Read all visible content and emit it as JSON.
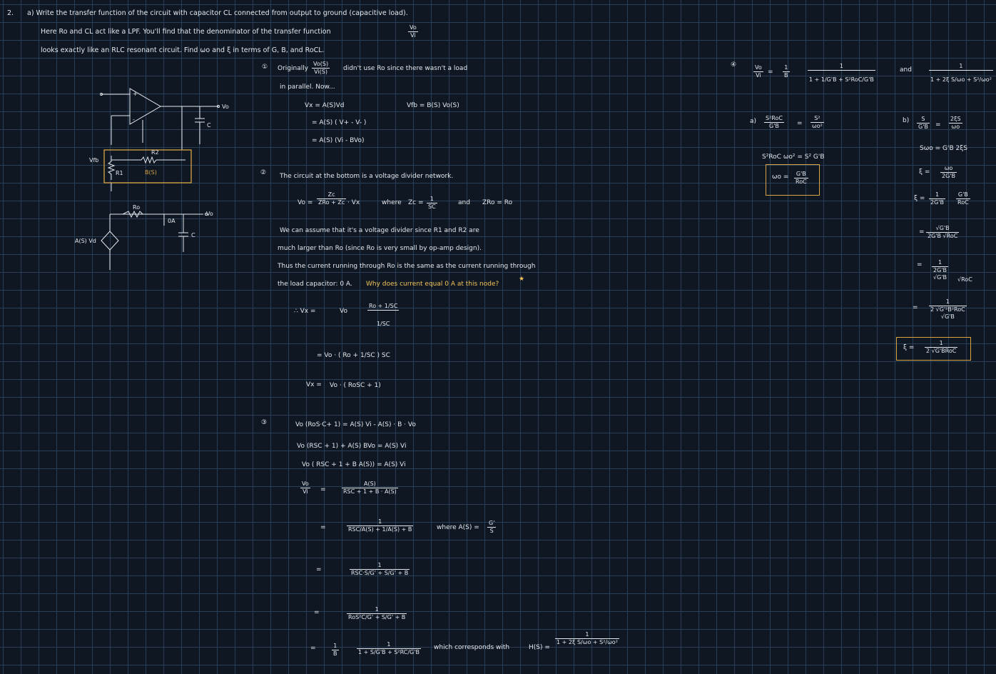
{
  "problem": {
    "number": "2.",
    "line1": "a) Write the transfer function of the circuit with capacitor CL connected from output to ground (capacitive load).",
    "line2": "Here Ro and CL act like a LPF. You'll find that the denominator of the transfer function",
    "line2_frac_num": "Vo",
    "line2_frac_den": "Vi",
    "line3": "looks exactly like an RLC resonant circuit. Find ωo and ξ in terms of G, B, and RoCL."
  },
  "circuit": {
    "vo_top": "Vo",
    "vfb": "Vfb",
    "r1": "R1",
    "r2": "R2",
    "b_of_s": "B(S)",
    "cap_top": "C",
    "ro": "Ro",
    "zero_a": "0A",
    "cap_bottom": "C",
    "vo_bottom": "Vo",
    "source": "A(S) Vd",
    "plus": "+",
    "minus": "-"
  },
  "step1": {
    "marker": "①",
    "text_a": "Originally",
    "frac_num": "Vo(S)",
    "frac_den": "Vi(S)",
    "text_b": "didn't use Ro since there wasn't a load",
    "text_c": "in parallel. Now...",
    "eq1": "Vx = A(S)Vd",
    "eq_vfb": "Vfb = B(S) Vo(S)",
    "eq2": "= A(S) ( V+ - V- )",
    "eq3": "= A(S) (Vi - BVo)"
  },
  "step2": {
    "marker": "②",
    "intro": "The circuit at the bottom is a voltage divider network.",
    "vo_eq": "Vo =",
    "zc_num": "Zc",
    "zc_den": "ZRo + Zc",
    "vx": "· Vx",
    "where": "where",
    "zc_def": "Zc =",
    "zc_def_num": "1",
    "zc_def_den": "SC",
    "and": "and",
    "zro_def": "ZRo = Ro",
    "assume1": "We can assume that it's a voltage divider since R1 and R2 are",
    "assume2": "much larger than Ro (since Ro is very small by op-amp design).",
    "thus": "Thus the current running through Ro is the same as the current running through",
    "load_a": "the load capacitor: 0 A.",
    "question": "Why does current equal 0 A at this node?",
    "star": "★",
    "therefore": "∴ Vx =",
    "vo": "Vo",
    "num_a": "Ro + 1/SC",
    "den_a": "1/SC",
    "eq_b": "= Vo · ( Ro + 1/SC ) SC",
    "eq_c_lhs": "Vx =",
    "eq_c": "Vo · ( RoSC + 1)"
  },
  "step3": {
    "marker": "③",
    "l1": "Vo (RoS·C+ 1) = A(S) Vi - A(S) · B · Vo",
    "l2": "Vo (RSC + 1) + A(S) BVo = A(S) Vi",
    "l3": "Vo ( RSC + 1 + B A(S)) = A(S) Vi",
    "ratio_num": "Vo",
    "ratio_den": "Vi",
    "f1_num": "A(S)",
    "f1_den": "RSC + 1 + B · A(S)",
    "f2_num": "1",
    "f2_den": "RSC/A(S) + 1/A(S) + B",
    "where_a": "where A(S) =",
    "where_num": "G'",
    "where_den": "S",
    "f3_num": "1",
    "f3_den": "RSC·S/G' + S/G' + B",
    "f4_num": "1",
    "f4_den": "RoS²C/G' + S/G' + B",
    "f5_pre_num": "1",
    "f5_pre_den": "B",
    "f5_num": "1",
    "f5_den": "1 + S/G'B + S²RC/G'B",
    "corresponds": "which corresponds with",
    "h_label": "H(S) =",
    "h_num": "1",
    "h_den": "1 + 2ξ S/ωo + S²/ωo²"
  },
  "step4": {
    "marker": "④",
    "lhs_num": "Vo",
    "lhs_den": "Vi",
    "pre_num": "1",
    "pre_den": "B",
    "main_num": "1",
    "main_den": "1 + 1/G'B + S²RoC/G'B",
    "and": "and",
    "h_num": "1",
    "h_den": "1 + 2ξ S/ωo + S²/ωo²",
    "a_label": "a)",
    "a_lhs_num": "S²RoC",
    "a_lhs_den": "G'B",
    "a_rhs_num": "S²",
    "a_rhs_den": "ωo²",
    "a_step": "S²RoC ωo² = S² G'B",
    "a_result": "ωo =",
    "a_result_num": "G'B",
    "a_result_den": "RoC",
    "b_label": "b)",
    "b_lhs_num": "S",
    "b_lhs_den": "G'B",
    "b_rhs_num": "2ξS",
    "b_rhs_den": "ωo",
    "b_step1": "Sωo = G'B 2ξS",
    "b_step2_lhs": "ξ =",
    "b_step2_num": "ωo",
    "b_step2_den": "2G'B",
    "b_step3_lhs": "ξ =",
    "b_step3_num": "1",
    "b_step3_den": "2G'B",
    "b_step3_root_num": "G'B",
    "b_step3_root_den": "RoC",
    "b_step4_num": "√G'B",
    "b_step4_den": "2G'B √RoC",
    "b_step5_num": "1",
    "b_step5_den_a": "2G'B",
    "b_step5_den_b": "√G'B",
    "b_step5_den_c": "√RoC",
    "b_step6_num": "1",
    "b_step6_den_a": "2 √G'²B²RoC",
    "b_step6_den_b": "√G'B",
    "eq": "=",
    "final_lhs": "ξ =",
    "final_num": "1",
    "final_den": "2 √G'BRoC"
  }
}
